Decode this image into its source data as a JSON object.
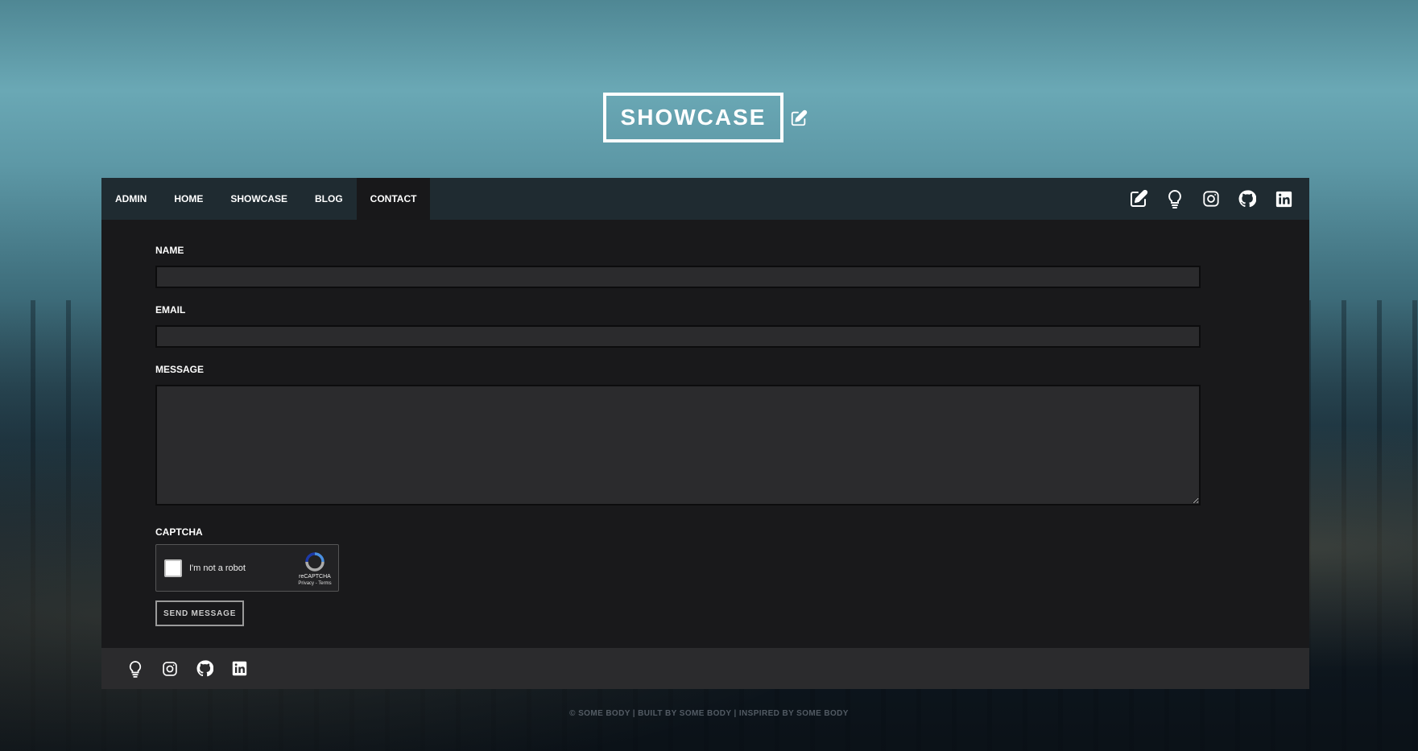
{
  "brand": {
    "title": "SHOWCASE",
    "edit_icon": "edit-icon"
  },
  "nav": {
    "links": [
      {
        "label": "ADMIN"
      },
      {
        "label": "HOME"
      },
      {
        "label": "SHOWCASE"
      },
      {
        "label": "BLOG"
      },
      {
        "label": "CONTACT",
        "active": true
      }
    ],
    "icons": [
      "edit-icon",
      "lightbulb-icon",
      "instagram-icon",
      "github-icon",
      "linkedin-icon"
    ]
  },
  "form": {
    "name_label": "NAME",
    "name_value": "",
    "email_label": "EMAIL",
    "email_value": "",
    "message_label": "MESSAGE",
    "message_value": "",
    "captcha_label": "CAPTCHA",
    "recaptcha": {
      "checkbox_text": "I'm not a robot",
      "brand": "reCAPTCHA",
      "links": "Privacy - Terms"
    },
    "send_label": "SEND MESSAGE"
  },
  "footer": {
    "icons": [
      "lightbulb-icon",
      "instagram-icon",
      "github-icon",
      "linkedin-icon"
    ],
    "copyright": "© SOME BODY | BUILT BY SOME BODY | INSPIRED BY SOME BODY"
  },
  "colors": {
    "navbar": "#1f2b31",
    "content_bg": "#19191b",
    "field_bg": "#2b2b2d",
    "footer_bg": "#2b2b2d",
    "text": "#ffffff"
  }
}
